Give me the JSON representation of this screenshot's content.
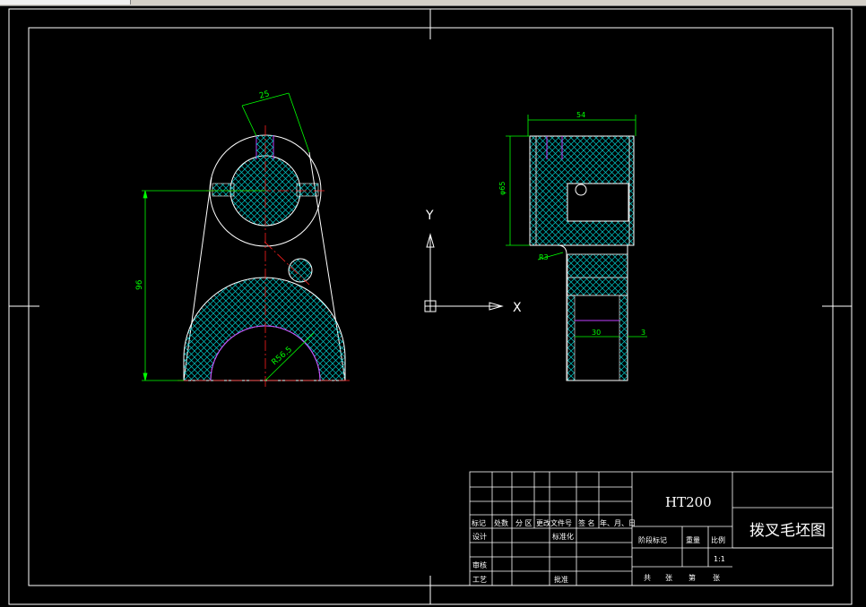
{
  "window": {
    "tab_label": ""
  },
  "colors": {
    "background": "#000000",
    "outline": "#ffffff",
    "dimension": "#00ff00",
    "centerline": "#ff2020",
    "hatch": "#00c8c8",
    "keyway": "#c040ff",
    "text": "#ffffff"
  },
  "front_view": {
    "dim_top": "25",
    "dim_height": "96",
    "dim_radius": "R56.5"
  },
  "side_view": {
    "dim_width": "54",
    "dim_height": "φ65",
    "dim_fillet": "R3",
    "dim_inner": "30",
    "dim_small": "3"
  },
  "ucs": {
    "y_label": "Y",
    "x_label": "X"
  },
  "title_block": {
    "material": "HT200",
    "drawing_title": "拨叉毛坯图",
    "header": [
      "标记",
      "处数",
      "分 区",
      "更改文件号",
      "签 名",
      "年、月、日"
    ],
    "design": "设计",
    "standardize": "标准化",
    "stage_mark": "阶段标记",
    "weight": "重量",
    "scale_label": "比例",
    "scale_value": "1:1",
    "review": "审核",
    "process": "工艺",
    "approve": "批准",
    "total": "共",
    "sheets": "张",
    "page": "第",
    "sheet_end": "张"
  }
}
